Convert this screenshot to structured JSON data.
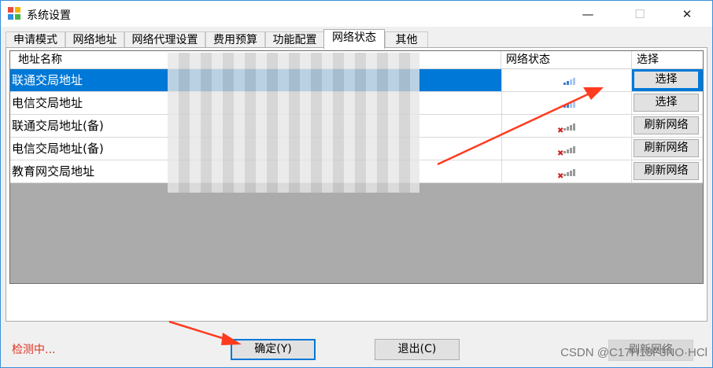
{
  "window": {
    "title": "系统设置",
    "minimize_glyph": "—",
    "maximize_glyph": "☐",
    "close_glyph": "✕"
  },
  "tabs": [
    {
      "label": "申请模式",
      "active": false
    },
    {
      "label": "网络地址",
      "active": false
    },
    {
      "label": "网络代理设置",
      "active": false
    },
    {
      "label": "费用预算",
      "active": false
    },
    {
      "label": "功能配置",
      "active": false
    },
    {
      "label": "网络状态",
      "active": true
    },
    {
      "label": "其他",
      "active": false
    }
  ],
  "grid": {
    "columns": [
      "地址名称",
      "网络状态",
      "选择"
    ],
    "rows": [
      {
        "name": "联通交局地址",
        "status": "checking",
        "action": "选择",
        "selected": true
      },
      {
        "name": "电信交局地址",
        "status": "checking",
        "action": "选择",
        "selected": false
      },
      {
        "name": "联通交局地址(备)",
        "status": "disconnected",
        "action": "刷新网络",
        "selected": false
      },
      {
        "name": "电信交局地址(备)",
        "status": "disconnected",
        "action": "刷新网络",
        "selected": false
      },
      {
        "name": "教育网交局地址",
        "status": "disconnected",
        "action": "刷新网络",
        "selected": false
      }
    ]
  },
  "refresh_button": "刷新网络",
  "status_text": "检测中...",
  "ok_button": "确定(Y)",
  "exit_button": "退出(C)",
  "watermark": "CSDN @C17H18F3NO·HCl",
  "colors": {
    "selection": "#0078d7",
    "status_text": "#e0301e",
    "annotation_arrow": "#ff3b1f"
  }
}
